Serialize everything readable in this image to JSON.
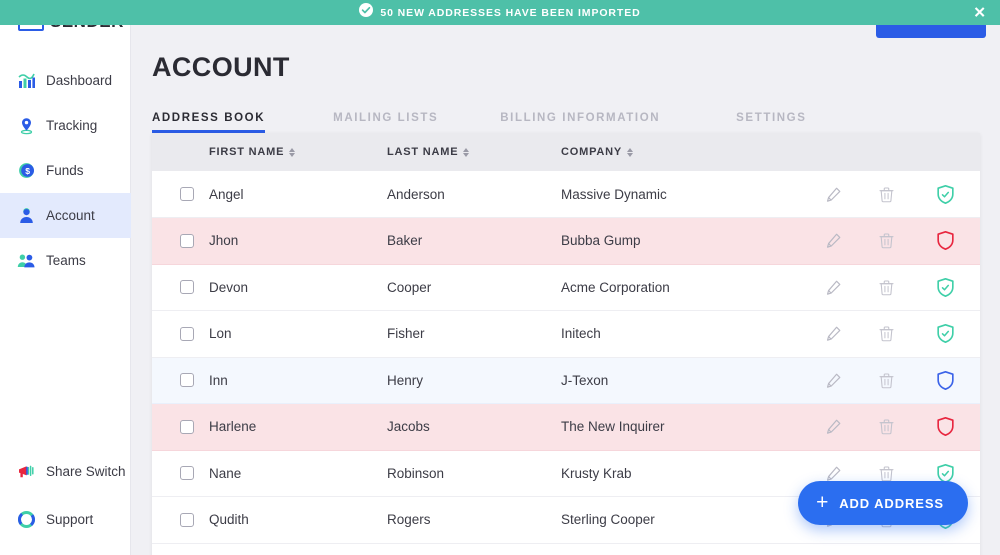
{
  "banner": {
    "icon": "check-circle-icon",
    "text": "50 NEW ADDRESSES HAVE BEEN IMPORTED",
    "close_label": "✕",
    "color": "#4EC0A8"
  },
  "brand": {
    "name": "SENDER",
    "logo_icon": "envelope-logo-icon"
  },
  "sidebar": {
    "items": [
      {
        "label": "Dashboard",
        "icon": "bar-chart-icon",
        "active": false
      },
      {
        "label": "Tracking",
        "icon": "map-pin-icon",
        "active": false
      },
      {
        "label": "Funds",
        "icon": "dollar-coin-icon",
        "active": false
      },
      {
        "label": "Account",
        "icon": "user-icon",
        "active": true
      },
      {
        "label": "Teams",
        "icon": "users-icon",
        "active": false
      }
    ],
    "bottom_items": [
      {
        "label": "Share Switch",
        "icon": "megaphone-icon"
      },
      {
        "label": "Support",
        "icon": "lifebuoy-icon"
      }
    ],
    "active_bg": "#E3EAFD"
  },
  "header": {
    "title": "ACCOUNT",
    "top_button_label": ""
  },
  "tabs": [
    {
      "label": "ADDRESS BOOK",
      "active": true
    },
    {
      "label": "MAILING LISTS",
      "active": false
    },
    {
      "label": "BILLING INFORMATION",
      "active": false
    },
    {
      "label": "SETTINGS",
      "active": false
    }
  ],
  "table": {
    "columns": [
      {
        "key": "checkbox",
        "label": "",
        "sortable": false
      },
      {
        "key": "first_name",
        "label": "FIRST NAME",
        "sortable": true
      },
      {
        "key": "last_name",
        "label": "LAST NAME",
        "sortable": true
      },
      {
        "key": "company",
        "label": "COMPANY",
        "sortable": true
      }
    ],
    "row_actions": [
      {
        "name": "edit-icon",
        "label": "Edit"
      },
      {
        "name": "delete-icon",
        "label": "Delete"
      },
      {
        "name": "shield-status-icon",
        "label": "Status"
      }
    ],
    "status_colors": {
      "verified": "#3FCFA8",
      "invalid": "#E8263F",
      "pending": "#3B63E8"
    },
    "rows": [
      {
        "first_name": "Angel",
        "last_name": "Anderson",
        "company": "Massive Dynamic",
        "status": "verified",
        "selected": false
      },
      {
        "first_name": "Jhon",
        "last_name": "Baker",
        "company": "Bubba Gump",
        "status": "invalid",
        "selected": false
      },
      {
        "first_name": "Devon",
        "last_name": "Cooper",
        "company": "Acme Corporation",
        "status": "verified",
        "selected": false
      },
      {
        "first_name": "Lon",
        "last_name": "Fisher",
        "company": "Initech",
        "status": "verified",
        "selected": false
      },
      {
        "first_name": "Inn",
        "last_name": "Henry",
        "company": "J-Texon",
        "status": "pending",
        "selected": false
      },
      {
        "first_name": "Harlene",
        "last_name": "Jacobs",
        "company": "The New Inquirer",
        "status": "invalid",
        "selected": false
      },
      {
        "first_name": "Nane",
        "last_name": "Robinson",
        "company": "Krusty Krab",
        "status": "verified",
        "selected": false
      },
      {
        "first_name": "Qudith",
        "last_name": "Rogers",
        "company": "Sterling Cooper",
        "status": "verified",
        "selected": false
      }
    ]
  },
  "fab": {
    "label": "ADD ADDRESS",
    "icon": "plus-icon",
    "color": "#2B6EF0"
  }
}
